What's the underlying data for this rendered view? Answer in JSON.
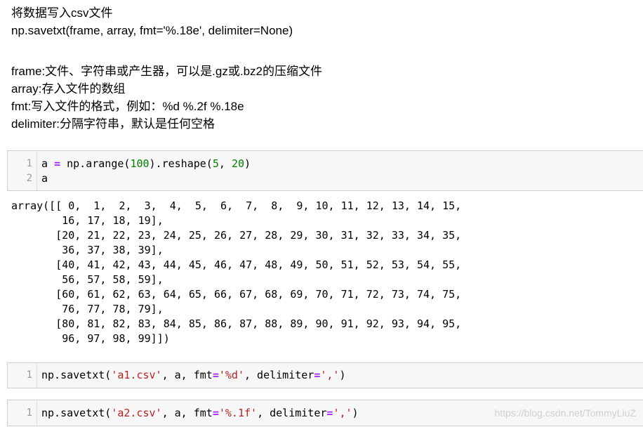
{
  "markdown": {
    "title": "将数据写入csv文件",
    "signature": "np.savetxt(frame, array, fmt='%.18e', delimiter=None)",
    "params": [
      "frame:文件、字符串或产生器，可以是.gz或.bz2的压缩文件",
      "array:存入文件的数组",
      "fmt:写入文件的格式，例如：%d %.2f %.18e",
      "delimiter:分隔字符串，默认是任何空格"
    ]
  },
  "cell1": {
    "line_numbers": [
      "1",
      "2"
    ],
    "line1": {
      "a": "a ",
      "eq": "=",
      "mid": " np.arange(",
      "n1": "100",
      "mid2": ").reshape(",
      "n2": "5",
      "comma": ", ",
      "n3": "20",
      "close": ")"
    },
    "line2": "a"
  },
  "output1": "array([[ 0,  1,  2,  3,  4,  5,  6,  7,  8,  9, 10, 11, 12, 13, 14, 15,\n        16, 17, 18, 19],\n       [20, 21, 22, 23, 24, 25, 26, 27, 28, 29, 30, 31, 32, 33, 34, 35,\n        36, 37, 38, 39],\n       [40, 41, 42, 43, 44, 45, 46, 47, 48, 49, 50, 51, 52, 53, 54, 55,\n        56, 57, 58, 59],\n       [60, 61, 62, 63, 64, 65, 66, 67, 68, 69, 70, 71, 72, 73, 74, 75,\n        76, 77, 78, 79],\n       [80, 81, 82, 83, 84, 85, 86, 87, 88, 89, 90, 91, 92, 93, 94, 95,\n        96, 97, 98, 99]])",
  "cell2": {
    "line_number": "1",
    "pre": "np.savetxt(",
    "s1": "'a1.csv'",
    "mid": ", a, fmt",
    "eq": "=",
    "s2": "'%d'",
    "mid2": ", delimiter",
    "eq2": "=",
    "s3": "','",
    "close": ")"
  },
  "cell3": {
    "line_number": "1",
    "pre": "np.savetxt(",
    "s1": "'a2.csv'",
    "mid": ", a, fmt",
    "eq": "=",
    "s2": "'%.1f'",
    "mid2": ", delimiter",
    "eq2": "=",
    "s3": "','",
    "close": ")"
  },
  "watermark": "https://blog.csdn.net/TommyLiuZ",
  "colors": {
    "cell_background": "#f7f7f7",
    "cell_border": "#cfcfcf",
    "operator": "#aa22ff",
    "number": "#008000",
    "string": "#ba2121",
    "line_number": "#999999"
  }
}
